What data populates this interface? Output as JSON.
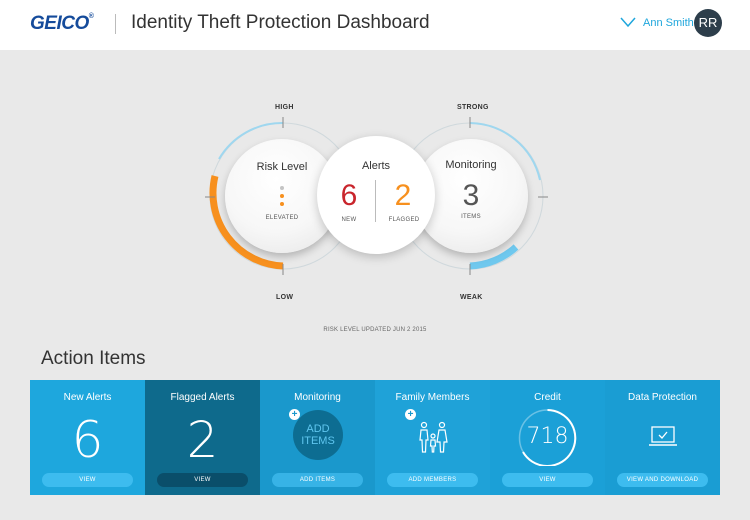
{
  "header": {
    "logo": "GEICO",
    "logo_mark": "®",
    "title": "Identity Theft Protection Dashboard",
    "user_name": "Ann Smith",
    "avatar_initials": "RR"
  },
  "gauges": {
    "risk": {
      "high_label": "HIGH",
      "low_label": "LOW",
      "title": "Risk Level",
      "status": "ELEVATED",
      "level": 0.5
    },
    "alerts": {
      "title": "Alerts",
      "new_count": "6",
      "new_label": "NEW",
      "flagged_count": "2",
      "flagged_label": "FLAGGED"
    },
    "monitoring": {
      "strong_label": "STRONG",
      "weak_label": "WEAK",
      "title": "Monitoring",
      "count": "3",
      "count_label": "ITEMS",
      "level": 0.15
    },
    "updated_text": "RISK LEVEL UPDATED JUN 2 2015"
  },
  "action_items": {
    "title": "Action Items",
    "tiles": [
      {
        "title": "New Alerts",
        "value": "6",
        "button": "VIEW"
      },
      {
        "title": "Flagged Alerts",
        "value": "2",
        "button": "VIEW"
      },
      {
        "title": "Monitoring",
        "add_text_1": "ADD",
        "add_text_2": "ITEMS",
        "button": "ADD ITEMS"
      },
      {
        "title": "Family Members",
        "button": "ADD MEMBERS"
      },
      {
        "title": "Credit",
        "value": "718",
        "button": "VIEW"
      },
      {
        "title": "Data Protection",
        "button": "VIEW AND DOWNLOAD"
      }
    ]
  },
  "colors": {
    "brand": "#154b9b",
    "accent_blue": "#1ea7dd",
    "dark_tile": "#0e6a8c",
    "risk_orange": "#f7901e",
    "alert_red": "#c9252c",
    "flagged_orange": "#f7901e",
    "monitor_blue": "#6fc8ee"
  }
}
